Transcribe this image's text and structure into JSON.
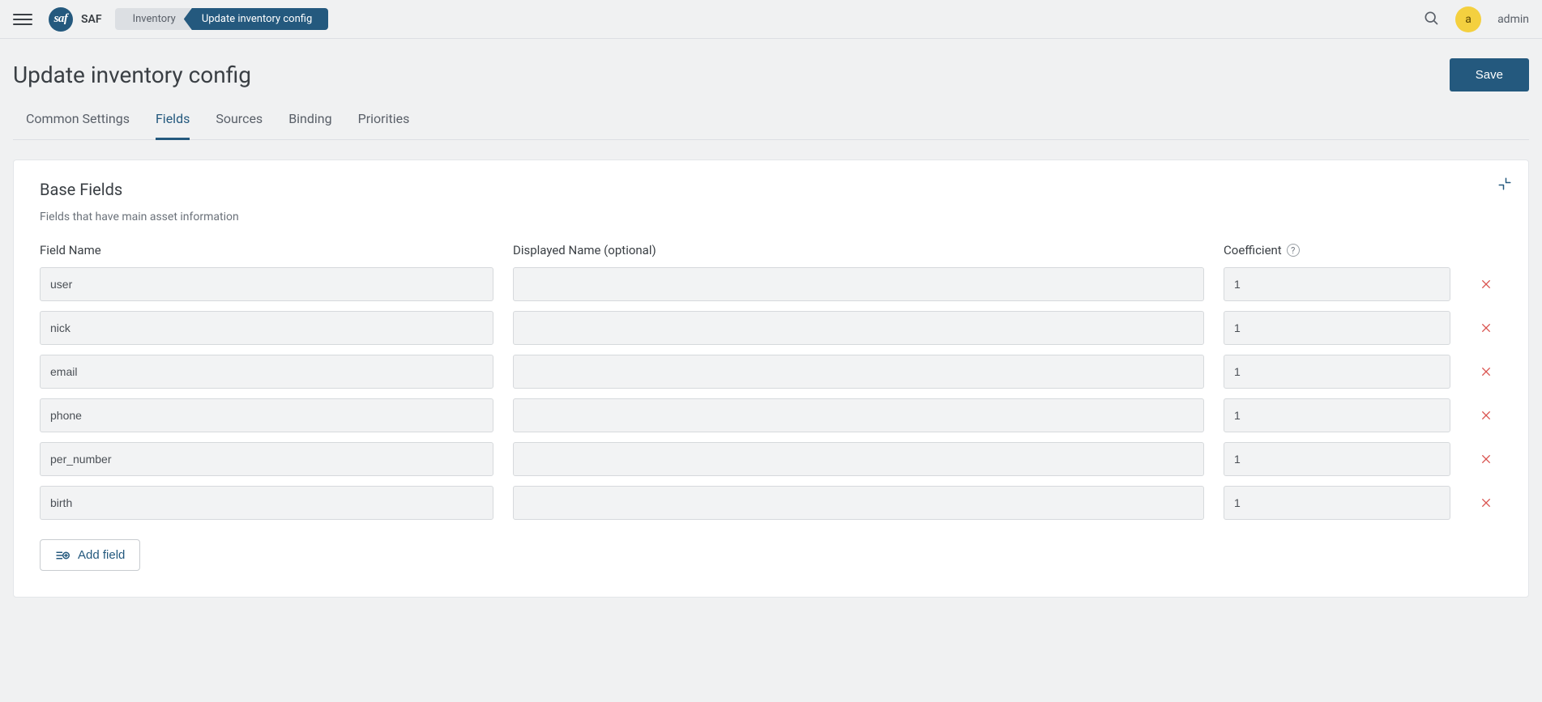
{
  "header": {
    "app_name": "SAF",
    "breadcrumb": [
      "Inventory",
      "Update inventory config"
    ],
    "user_avatar_initial": "a",
    "username": "admin"
  },
  "page": {
    "title": "Update inventory config",
    "save_label": "Save"
  },
  "tabs": [
    {
      "label": "Common Settings",
      "active": false
    },
    {
      "label": "Fields",
      "active": true
    },
    {
      "label": "Sources",
      "active": false
    },
    {
      "label": "Binding",
      "active": false
    },
    {
      "label": "Priorities",
      "active": false
    }
  ],
  "card": {
    "title": "Base Fields",
    "subtitle": "Fields that have main asset information",
    "columns": {
      "name": "Field Name",
      "displayed": "Displayed Name (optional)",
      "coefficient": "Coefficient"
    },
    "rows": [
      {
        "name": "user",
        "displayed": "",
        "coefficient": "1"
      },
      {
        "name": "nick",
        "displayed": "",
        "coefficient": "1"
      },
      {
        "name": "email",
        "displayed": "",
        "coefficient": "1"
      },
      {
        "name": "phone",
        "displayed": "",
        "coefficient": "1"
      },
      {
        "name": "per_number",
        "displayed": "",
        "coefficient": "1"
      },
      {
        "name": "birth",
        "displayed": "",
        "coefficient": "1"
      }
    ],
    "add_field_label": "Add field"
  }
}
